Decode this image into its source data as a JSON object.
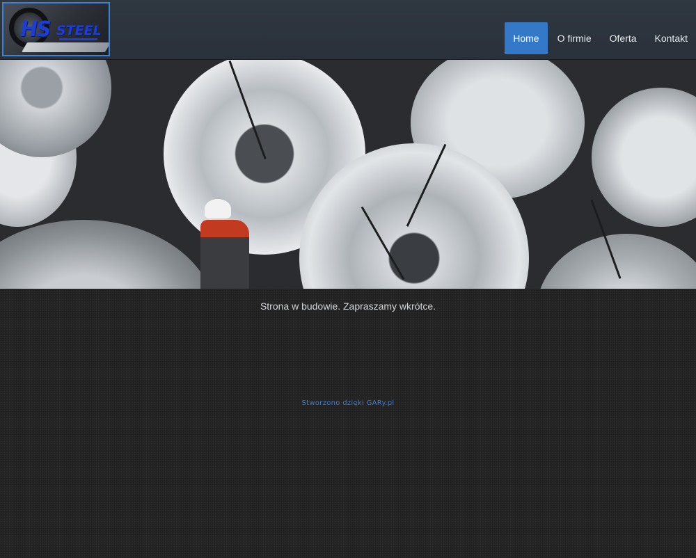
{
  "brand": {
    "logo_letters": "HS",
    "logo_word": "STEEL",
    "accent_color": "#3478c8"
  },
  "nav": {
    "items": [
      {
        "label": "Home",
        "active": true
      },
      {
        "label": "O firmie",
        "active": false
      },
      {
        "label": "Oferta",
        "active": false
      },
      {
        "label": "Kontakt",
        "active": false
      }
    ]
  },
  "slider": {
    "slide_count": 3,
    "active_index": 0
  },
  "main": {
    "notice": "Strona w budowie. Zapraszamy wkrótce."
  },
  "footer": {
    "credit": "Stworzono dzięki GARy.pl"
  }
}
